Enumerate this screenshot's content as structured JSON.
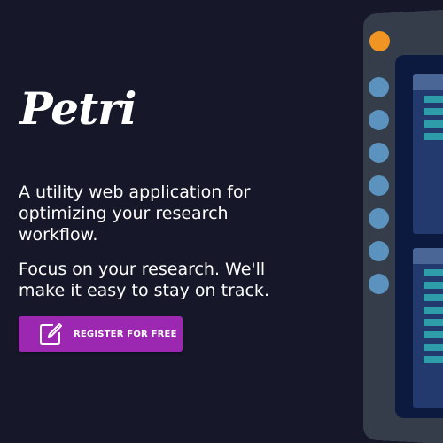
{
  "brand": {
    "logo_text": "Petri"
  },
  "hero": {
    "tagline": "A utility web application for optimizing your research workflow.",
    "subline": "Focus on your research. We'll make it easy to stay on track.",
    "cta_label": "REGISTER FOR FREE",
    "cta_icon": "edit-icon"
  },
  "colors": {
    "background": "#16182a",
    "cta": "#9c27b0",
    "accent_orange": "#f09424",
    "nav_dot": "#5b93be",
    "device_frame": "#363d4a"
  }
}
